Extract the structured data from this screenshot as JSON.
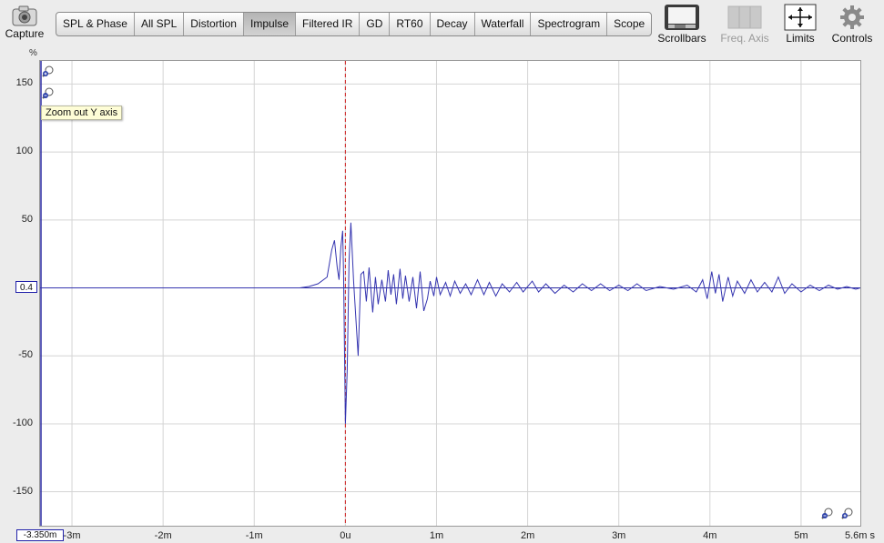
{
  "toolbar": {
    "capture_label": "Capture",
    "tabs": [
      "SPL & Phase",
      "All SPL",
      "Distortion",
      "Impulse",
      "Filtered IR",
      "GD",
      "RT60",
      "Decay",
      "Waterfall",
      "Spectrogram",
      "Scope"
    ],
    "active_tab": "Impulse",
    "scrollbars_label": "Scrollbars",
    "freq_axis_label": "Freq. Axis",
    "limits_label": "Limits",
    "controls_label": "Controls"
  },
  "graph": {
    "y_unit": "%",
    "x_unit": "5.6m s",
    "cursor_y_value": "0.4",
    "cursor_x_value": "-3.350m",
    "tooltip": "Zoom out Y axis"
  },
  "chart_data": {
    "type": "line",
    "xlabel": "",
    "ylabel": "%",
    "xlim": [
      -3.35,
      5.65
    ],
    "ylim": [
      -175,
      167
    ],
    "x_unit": "ms",
    "grid": true,
    "x_ticks": [
      {
        "value": -3,
        "label": "-3m"
      },
      {
        "value": -2,
        "label": "-2m"
      },
      {
        "value": -1,
        "label": "-1m"
      },
      {
        "value": 0,
        "label": "0u"
      },
      {
        "value": 1,
        "label": "1m"
      },
      {
        "value": 2,
        "label": "2m"
      },
      {
        "value": 3,
        "label": "3m"
      },
      {
        "value": 4,
        "label": "4m"
      },
      {
        "value": 5,
        "label": "5m"
      }
    ],
    "y_ticks": [
      {
        "value": 150,
        "label": "150"
      },
      {
        "value": 100,
        "label": "100"
      },
      {
        "value": 50,
        "label": "50"
      },
      {
        "value": -50,
        "label": "-50"
      },
      {
        "value": -100,
        "label": "-100"
      },
      {
        "value": -150,
        "label": "-150"
      }
    ],
    "peak_marker_x": 0,
    "series": [
      {
        "color": "#3535b0",
        "points": [
          [
            -3.35,
            0
          ],
          [
            -0.5,
            0
          ],
          [
            -0.4,
            1
          ],
          [
            -0.3,
            3
          ],
          [
            -0.2,
            8
          ],
          [
            -0.15,
            28
          ],
          [
            -0.12,
            35
          ],
          [
            -0.09,
            15
          ],
          [
            -0.07,
            6
          ],
          [
            -0.05,
            30
          ],
          [
            -0.03,
            42
          ],
          [
            -0.02,
            10
          ],
          [
            0,
            -100
          ],
          [
            0.02,
            -60
          ],
          [
            0.04,
            20
          ],
          [
            0.06,
            48
          ],
          [
            0.09,
            5
          ],
          [
            0.12,
            -28
          ],
          [
            0.14,
            -50
          ],
          [
            0.17,
            10
          ],
          [
            0.2,
            12
          ],
          [
            0.23,
            -10
          ],
          [
            0.26,
            15
          ],
          [
            0.3,
            -18
          ],
          [
            0.33,
            8
          ],
          [
            0.36,
            -12
          ],
          [
            0.4,
            6
          ],
          [
            0.44,
            -10
          ],
          [
            0.47,
            13
          ],
          [
            0.5,
            -5
          ],
          [
            0.53,
            10
          ],
          [
            0.56,
            -12
          ],
          [
            0.6,
            14
          ],
          [
            0.63,
            -8
          ],
          [
            0.66,
            9
          ],
          [
            0.7,
            -10
          ],
          [
            0.74,
            8
          ],
          [
            0.78,
            -15
          ],
          [
            0.82,
            12
          ],
          [
            0.86,
            -17
          ],
          [
            0.9,
            -8
          ],
          [
            0.93,
            5
          ],
          [
            0.97,
            -6
          ],
          [
            1.0,
            8
          ],
          [
            1.04,
            -5
          ],
          [
            1.1,
            4
          ],
          [
            1.15,
            -6
          ],
          [
            1.2,
            5
          ],
          [
            1.26,
            -4
          ],
          [
            1.32,
            3
          ],
          [
            1.38,
            -5
          ],
          [
            1.45,
            6
          ],
          [
            1.52,
            -5
          ],
          [
            1.58,
            4
          ],
          [
            1.65,
            -6
          ],
          [
            1.72,
            3
          ],
          [
            1.8,
            -3
          ],
          [
            1.88,
            4
          ],
          [
            1.95,
            -3
          ],
          [
            2.05,
            5
          ],
          [
            2.12,
            -3
          ],
          [
            2.2,
            3
          ],
          [
            2.3,
            -4
          ],
          [
            2.4,
            2
          ],
          [
            2.5,
            -3
          ],
          [
            2.6,
            3
          ],
          [
            2.7,
            -2
          ],
          [
            2.8,
            3
          ],
          [
            2.9,
            -2
          ],
          [
            3.0,
            2
          ],
          [
            3.1,
            -2
          ],
          [
            3.2,
            3
          ],
          [
            3.3,
            -2
          ],
          [
            3.45,
            1
          ],
          [
            3.6,
            -1
          ],
          [
            3.75,
            2
          ],
          [
            3.85,
            -3
          ],
          [
            3.92,
            6
          ],
          [
            3.97,
            -8
          ],
          [
            4.02,
            12
          ],
          [
            4.06,
            -4
          ],
          [
            4.1,
            10
          ],
          [
            4.14,
            -10
          ],
          [
            4.2,
            8
          ],
          [
            4.25,
            -6
          ],
          [
            4.3,
            5
          ],
          [
            4.38,
            -4
          ],
          [
            4.45,
            6
          ],
          [
            4.52,
            -3
          ],
          [
            4.6,
            4
          ],
          [
            4.68,
            -3
          ],
          [
            4.75,
            8
          ],
          [
            4.82,
            -4
          ],
          [
            4.9,
            3
          ],
          [
            5.0,
            -3
          ],
          [
            5.1,
            2
          ],
          [
            5.2,
            -2
          ],
          [
            5.3,
            2
          ],
          [
            5.4,
            -1
          ],
          [
            5.5,
            1
          ],
          [
            5.6,
            -1
          ],
          [
            5.65,
            0
          ]
        ]
      }
    ]
  }
}
